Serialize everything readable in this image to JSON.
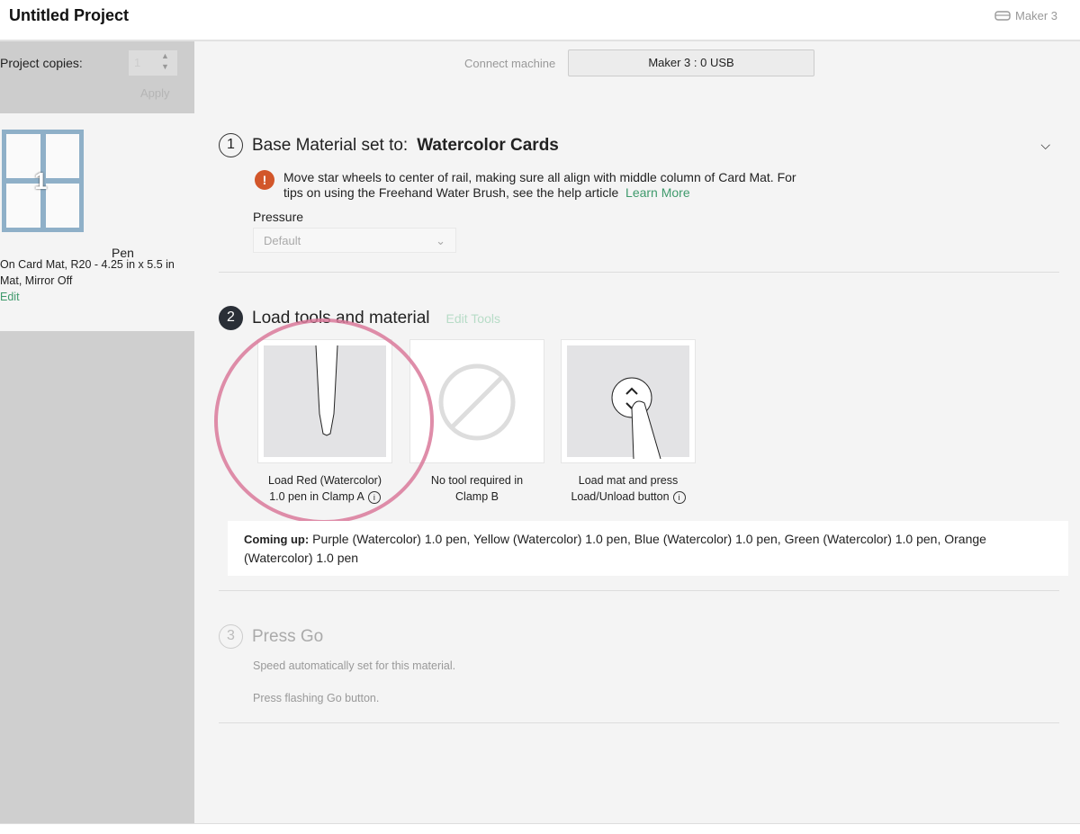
{
  "header": {
    "title": "Untitled Project",
    "machine": "Maker 3",
    "machine_icon": "machine-icon"
  },
  "sidebar": {
    "copies_label": "Project copies:",
    "copies_value": "1",
    "apply": "Apply",
    "mat_number": "1",
    "tool": "Pen",
    "mat_line1": "On Card Mat, R20 - 4.25 in x 5.5 in",
    "mat_line2": "Mat, Mirror Off",
    "edit": "Edit"
  },
  "connect": {
    "label": "Connect machine",
    "value": "Maker 3 : 0 USB"
  },
  "step1": {
    "number": "1",
    "prefix": "Base Material set to:",
    "material": "Watercolor Cards",
    "warning": "Move star wheels to center of rail, making sure all align with middle column of Card Mat. For tips on using the Freehand Water Brush, see the help article",
    "learn_more": "Learn More",
    "pressure_label": "Pressure",
    "pressure_value": "Default"
  },
  "step2": {
    "number": "2",
    "title": "Load tools and material",
    "edit_tools": "Edit Tools",
    "tiles": [
      {
        "caption1": "Load Red (Watercolor)",
        "caption2": "1.0 pen in Clamp A"
      },
      {
        "caption1": "No tool required in",
        "caption2": "Clamp B"
      },
      {
        "caption1": "Load mat and press",
        "caption2": "Load/Unload button"
      }
    ],
    "coming_label": "Coming up:",
    "coming_text": "Purple (Watercolor) 1.0 pen, Yellow (Watercolor) 1.0 pen, Blue (Watercolor) 1.0 pen, Green (Watercolor) 1.0 pen, Orange (Watercolor) 1.0 pen"
  },
  "step3": {
    "number": "3",
    "title": "Press Go",
    "speed": "Speed automatically set for this material.",
    "press": "Press flashing Go button."
  },
  "colors": {
    "accent": "#3f9a6c",
    "warning": "#d2562a",
    "highlight_circle": "#d9799a"
  }
}
